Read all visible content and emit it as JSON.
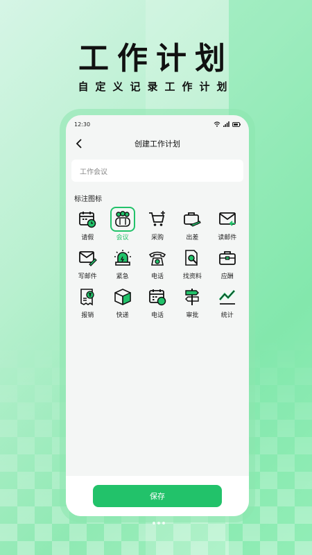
{
  "promo": {
    "headline": "工作计划",
    "subline": "自定义记录工作计划"
  },
  "status_bar": {
    "time": "12:30"
  },
  "nav": {
    "title": "创建工作计划",
    "back_icon": "chevron-left-icon"
  },
  "input": {
    "value": "工作会议"
  },
  "icon_section": {
    "label": "标注图标"
  },
  "icons": [
    {
      "label": "请假",
      "icon": "calendar-clock-icon",
      "selected": false
    },
    {
      "label": "会议",
      "icon": "people-group-icon",
      "selected": true
    },
    {
      "label": "采购",
      "icon": "shopping-cart-icon",
      "selected": false
    },
    {
      "label": "出差",
      "icon": "suitcase-plane-icon",
      "selected": false
    },
    {
      "label": "读邮件",
      "icon": "mail-read-icon",
      "selected": false
    },
    {
      "label": "写邮件",
      "icon": "mail-write-icon",
      "selected": false
    },
    {
      "label": "紧急",
      "icon": "alarm-light-icon",
      "selected": false
    },
    {
      "label": "电话",
      "icon": "telephone-icon",
      "selected": false
    },
    {
      "label": "找资料",
      "icon": "document-search-icon",
      "selected": false
    },
    {
      "label": "应酬",
      "icon": "briefcase-icon",
      "selected": false
    },
    {
      "label": "报销",
      "icon": "receipt-yen-icon",
      "selected": false
    },
    {
      "label": "快递",
      "icon": "package-box-icon",
      "selected": false
    },
    {
      "label": "电话",
      "icon": "calendar-phone-icon",
      "selected": false
    },
    {
      "label": "审批",
      "icon": "signpost-icon",
      "selected": false
    },
    {
      "label": "统计",
      "icon": "trend-line-icon",
      "selected": false
    }
  ],
  "footer": {
    "save_label": "保存"
  },
  "colors": {
    "accent": "#22c26a",
    "ink": "#111111"
  }
}
